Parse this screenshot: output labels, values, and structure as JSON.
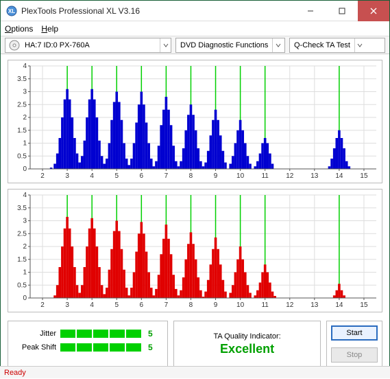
{
  "window": {
    "title": "PlexTools Professional XL V3.16"
  },
  "menu": {
    "options": "Options",
    "help": "Help"
  },
  "toolbar": {
    "drive": "HA:7 ID:0   PX-760A",
    "func": "DVD Diagnostic Functions",
    "test": "Q-Check TA Test"
  },
  "metrics": {
    "jitter_label": "Jitter",
    "jitter_val": "5",
    "peak_label": "Peak Shift",
    "peak_val": "5"
  },
  "quality": {
    "label": "TA Quality Indicator:",
    "value": "Excellent"
  },
  "actions": {
    "start": "Start",
    "stop": "Stop"
  },
  "status": "Ready",
  "chart_data": [
    {
      "type": "bar",
      "color": "#0000d0",
      "ylim": [
        0,
        4
      ],
      "yticks": [
        0,
        0.5,
        1,
        1.5,
        2,
        2.5,
        3,
        3.5,
        4
      ],
      "xlim": [
        1.5,
        15.5
      ],
      "xticks": [
        2,
        3,
        4,
        5,
        6,
        7,
        8,
        9,
        10,
        11,
        12,
        13,
        14,
        15
      ],
      "marks": [
        3,
        4,
        5,
        6,
        7,
        8,
        9,
        10,
        11,
        14
      ],
      "bins": [
        {
          "x": 2.35,
          "y": 0.05
        },
        {
          "x": 2.5,
          "y": 0.2
        },
        {
          "x": 2.6,
          "y": 0.6
        },
        {
          "x": 2.7,
          "y": 1.2
        },
        {
          "x": 2.8,
          "y": 2.0
        },
        {
          "x": 2.9,
          "y": 2.7
        },
        {
          "x": 3.0,
          "y": 3.1
        },
        {
          "x": 3.1,
          "y": 2.7
        },
        {
          "x": 3.2,
          "y": 2.0
        },
        {
          "x": 3.3,
          "y": 1.2
        },
        {
          "x": 3.4,
          "y": 0.6
        },
        {
          "x": 3.5,
          "y": 0.25
        },
        {
          "x": 3.6,
          "y": 0.5
        },
        {
          "x": 3.7,
          "y": 1.1
        },
        {
          "x": 3.8,
          "y": 2.0
        },
        {
          "x": 3.9,
          "y": 2.7
        },
        {
          "x": 4.0,
          "y": 3.1
        },
        {
          "x": 4.1,
          "y": 2.7
        },
        {
          "x": 4.2,
          "y": 2.0
        },
        {
          "x": 4.3,
          "y": 1.1
        },
        {
          "x": 4.4,
          "y": 0.5
        },
        {
          "x": 4.5,
          "y": 0.2
        },
        {
          "x": 4.6,
          "y": 0.4
        },
        {
          "x": 4.7,
          "y": 1.0
        },
        {
          "x": 4.8,
          "y": 1.9
        },
        {
          "x": 4.9,
          "y": 2.6
        },
        {
          "x": 5.0,
          "y": 3.0
        },
        {
          "x": 5.1,
          "y": 2.6
        },
        {
          "x": 5.2,
          "y": 1.9
        },
        {
          "x": 5.3,
          "y": 1.0
        },
        {
          "x": 5.4,
          "y": 0.4
        },
        {
          "x": 5.5,
          "y": 0.15
        },
        {
          "x": 5.6,
          "y": 0.4
        },
        {
          "x": 5.7,
          "y": 1.0
        },
        {
          "x": 5.8,
          "y": 1.8
        },
        {
          "x": 5.9,
          "y": 2.5
        },
        {
          "x": 6.0,
          "y": 3.0
        },
        {
          "x": 6.1,
          "y": 2.5
        },
        {
          "x": 6.2,
          "y": 1.8
        },
        {
          "x": 6.3,
          "y": 1.0
        },
        {
          "x": 6.4,
          "y": 0.4
        },
        {
          "x": 6.5,
          "y": 0.1
        },
        {
          "x": 6.6,
          "y": 0.3
        },
        {
          "x": 6.7,
          "y": 0.9
        },
        {
          "x": 6.8,
          "y": 1.7
        },
        {
          "x": 6.9,
          "y": 2.3
        },
        {
          "x": 7.0,
          "y": 2.8
        },
        {
          "x": 7.1,
          "y": 2.3
        },
        {
          "x": 7.2,
          "y": 1.7
        },
        {
          "x": 7.3,
          "y": 0.9
        },
        {
          "x": 7.4,
          "y": 0.3
        },
        {
          "x": 7.5,
          "y": 0.1
        },
        {
          "x": 7.6,
          "y": 0.3
        },
        {
          "x": 7.7,
          "y": 0.8
        },
        {
          "x": 7.8,
          "y": 1.5
        },
        {
          "x": 7.9,
          "y": 2.1
        },
        {
          "x": 8.0,
          "y": 2.5
        },
        {
          "x": 8.1,
          "y": 2.1
        },
        {
          "x": 8.2,
          "y": 1.5
        },
        {
          "x": 8.3,
          "y": 0.8
        },
        {
          "x": 8.4,
          "y": 0.3
        },
        {
          "x": 8.5,
          "y": 0.1
        },
        {
          "x": 8.6,
          "y": 0.25
        },
        {
          "x": 8.7,
          "y": 0.7
        },
        {
          "x": 8.8,
          "y": 1.3
        },
        {
          "x": 8.9,
          "y": 1.9
        },
        {
          "x": 9.0,
          "y": 2.3
        },
        {
          "x": 9.1,
          "y": 1.9
        },
        {
          "x": 9.2,
          "y": 1.3
        },
        {
          "x": 9.3,
          "y": 0.7
        },
        {
          "x": 9.4,
          "y": 0.25
        },
        {
          "x": 9.6,
          "y": 0.2
        },
        {
          "x": 9.7,
          "y": 0.5
        },
        {
          "x": 9.8,
          "y": 1.0
        },
        {
          "x": 9.9,
          "y": 1.5
        },
        {
          "x": 10.0,
          "y": 1.9
        },
        {
          "x": 10.1,
          "y": 1.5
        },
        {
          "x": 10.2,
          "y": 1.0
        },
        {
          "x": 10.3,
          "y": 0.5
        },
        {
          "x": 10.4,
          "y": 0.2
        },
        {
          "x": 10.6,
          "y": 0.1
        },
        {
          "x": 10.7,
          "y": 0.3
        },
        {
          "x": 10.8,
          "y": 0.6
        },
        {
          "x": 10.9,
          "y": 1.0
        },
        {
          "x": 11.0,
          "y": 1.2
        },
        {
          "x": 11.1,
          "y": 1.0
        },
        {
          "x": 11.2,
          "y": 0.6
        },
        {
          "x": 11.3,
          "y": 0.2
        },
        {
          "x": 13.6,
          "y": 0.1
        },
        {
          "x": 13.7,
          "y": 0.4
        },
        {
          "x": 13.8,
          "y": 0.8
        },
        {
          "x": 13.9,
          "y": 1.2
        },
        {
          "x": 14.0,
          "y": 1.5
        },
        {
          "x": 14.1,
          "y": 1.2
        },
        {
          "x": 14.2,
          "y": 0.8
        },
        {
          "x": 14.3,
          "y": 0.3
        },
        {
          "x": 14.4,
          "y": 0.1
        }
      ]
    },
    {
      "type": "bar",
      "color": "#e00000",
      "ylim": [
        0,
        4
      ],
      "yticks": [
        0,
        0.5,
        1,
        1.5,
        2,
        2.5,
        3,
        3.5,
        4
      ],
      "xlim": [
        1.5,
        15.5
      ],
      "xticks": [
        2,
        3,
        4,
        5,
        6,
        7,
        8,
        9,
        10,
        11,
        12,
        13,
        14,
        15
      ],
      "marks": [
        3,
        4,
        5,
        6,
        7,
        8,
        9,
        10,
        11,
        14
      ],
      "bins": [
        {
          "x": 2.5,
          "y": 0.1
        },
        {
          "x": 2.6,
          "y": 0.5
        },
        {
          "x": 2.7,
          "y": 1.2
        },
        {
          "x": 2.8,
          "y": 2.0
        },
        {
          "x": 2.9,
          "y": 2.7
        },
        {
          "x": 3.0,
          "y": 3.15
        },
        {
          "x": 3.1,
          "y": 2.7
        },
        {
          "x": 3.2,
          "y": 2.0
        },
        {
          "x": 3.3,
          "y": 1.2
        },
        {
          "x": 3.4,
          "y": 0.5
        },
        {
          "x": 3.5,
          "y": 0.2
        },
        {
          "x": 3.6,
          "y": 0.5
        },
        {
          "x": 3.7,
          "y": 1.2
        },
        {
          "x": 3.8,
          "y": 2.0
        },
        {
          "x": 3.9,
          "y": 2.7
        },
        {
          "x": 4.0,
          "y": 3.1
        },
        {
          "x": 4.1,
          "y": 2.7
        },
        {
          "x": 4.2,
          "y": 2.0
        },
        {
          "x": 4.3,
          "y": 1.2
        },
        {
          "x": 4.4,
          "y": 0.5
        },
        {
          "x": 4.5,
          "y": 0.15
        },
        {
          "x": 4.6,
          "y": 0.4
        },
        {
          "x": 4.7,
          "y": 1.1
        },
        {
          "x": 4.8,
          "y": 1.9
        },
        {
          "x": 4.9,
          "y": 2.6
        },
        {
          "x": 5.0,
          "y": 3.0
        },
        {
          "x": 5.1,
          "y": 2.6
        },
        {
          "x": 5.2,
          "y": 1.9
        },
        {
          "x": 5.3,
          "y": 1.1
        },
        {
          "x": 5.4,
          "y": 0.4
        },
        {
          "x": 5.5,
          "y": 0.1
        },
        {
          "x": 5.6,
          "y": 0.4
        },
        {
          "x": 5.7,
          "y": 1.0
        },
        {
          "x": 5.8,
          "y": 1.8
        },
        {
          "x": 5.9,
          "y": 2.5
        },
        {
          "x": 6.0,
          "y": 2.95
        },
        {
          "x": 6.1,
          "y": 2.5
        },
        {
          "x": 6.2,
          "y": 1.8
        },
        {
          "x": 6.3,
          "y": 1.0
        },
        {
          "x": 6.4,
          "y": 0.4
        },
        {
          "x": 6.5,
          "y": 0.1
        },
        {
          "x": 6.6,
          "y": 0.35
        },
        {
          "x": 6.7,
          "y": 0.9
        },
        {
          "x": 6.8,
          "y": 1.7
        },
        {
          "x": 6.9,
          "y": 2.3
        },
        {
          "x": 7.0,
          "y": 2.85
        },
        {
          "x": 7.1,
          "y": 2.3
        },
        {
          "x": 7.2,
          "y": 1.7
        },
        {
          "x": 7.3,
          "y": 0.9
        },
        {
          "x": 7.4,
          "y": 0.35
        },
        {
          "x": 7.5,
          "y": 0.1
        },
        {
          "x": 7.6,
          "y": 0.3
        },
        {
          "x": 7.7,
          "y": 0.8
        },
        {
          "x": 7.8,
          "y": 1.5
        },
        {
          "x": 7.9,
          "y": 2.1
        },
        {
          "x": 8.0,
          "y": 2.55
        },
        {
          "x": 8.1,
          "y": 2.1
        },
        {
          "x": 8.2,
          "y": 1.5
        },
        {
          "x": 8.3,
          "y": 0.8
        },
        {
          "x": 8.4,
          "y": 0.3
        },
        {
          "x": 8.5,
          "y": 0.05
        },
        {
          "x": 8.6,
          "y": 0.25
        },
        {
          "x": 8.7,
          "y": 0.7
        },
        {
          "x": 8.8,
          "y": 1.3
        },
        {
          "x": 8.9,
          "y": 1.9
        },
        {
          "x": 9.0,
          "y": 2.35
        },
        {
          "x": 9.1,
          "y": 1.9
        },
        {
          "x": 9.2,
          "y": 1.3
        },
        {
          "x": 9.3,
          "y": 0.7
        },
        {
          "x": 9.4,
          "y": 0.25
        },
        {
          "x": 9.6,
          "y": 0.2
        },
        {
          "x": 9.7,
          "y": 0.5
        },
        {
          "x": 9.8,
          "y": 1.0
        },
        {
          "x": 9.9,
          "y": 1.5
        },
        {
          "x": 10.0,
          "y": 2.0
        },
        {
          "x": 10.1,
          "y": 1.5
        },
        {
          "x": 10.2,
          "y": 1.0
        },
        {
          "x": 10.3,
          "y": 0.5
        },
        {
          "x": 10.4,
          "y": 0.2
        },
        {
          "x": 10.6,
          "y": 0.1
        },
        {
          "x": 10.7,
          "y": 0.3
        },
        {
          "x": 10.8,
          "y": 0.6
        },
        {
          "x": 10.9,
          "y": 1.0
        },
        {
          "x": 11.0,
          "y": 1.3
        },
        {
          "x": 11.1,
          "y": 1.0
        },
        {
          "x": 11.2,
          "y": 0.6
        },
        {
          "x": 11.3,
          "y": 0.25
        },
        {
          "x": 11.4,
          "y": 0.08
        },
        {
          "x": 13.8,
          "y": 0.1
        },
        {
          "x": 13.9,
          "y": 0.3
        },
        {
          "x": 14.0,
          "y": 0.55
        },
        {
          "x": 14.1,
          "y": 0.3
        },
        {
          "x": 14.2,
          "y": 0.1
        }
      ]
    }
  ]
}
